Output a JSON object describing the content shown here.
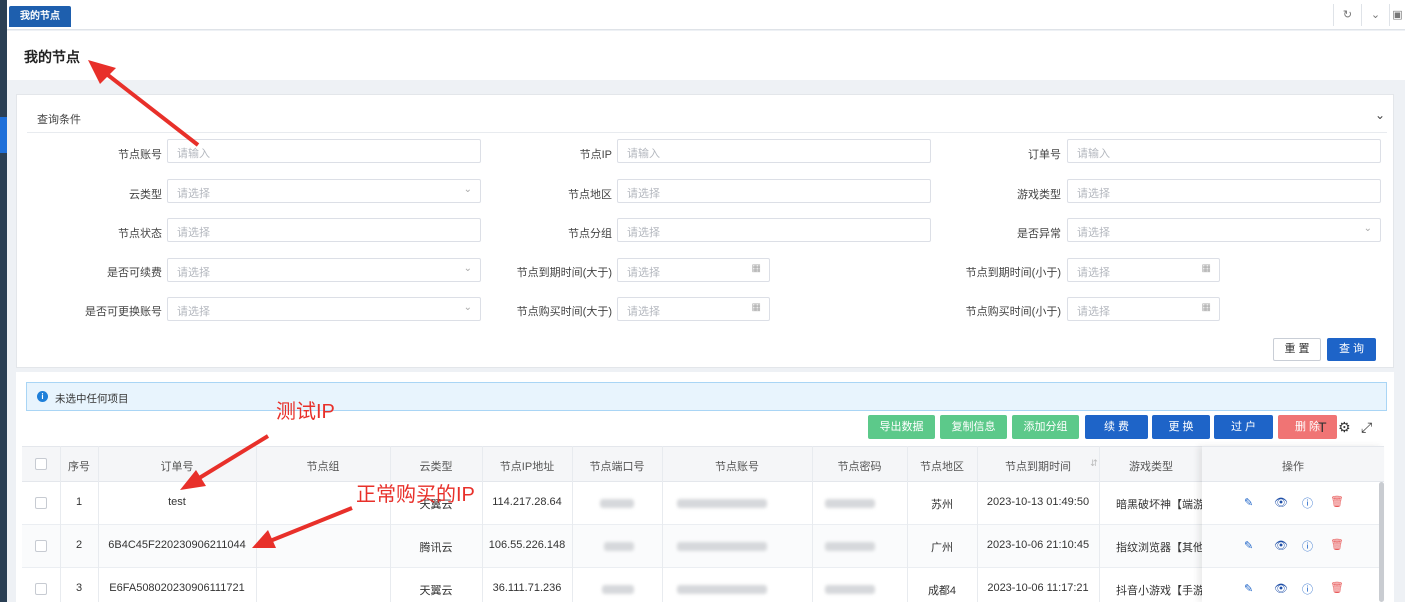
{
  "tabs": {
    "active_label": "我的节点"
  },
  "page": {
    "title": "我的节点"
  },
  "query": {
    "title": "查询条件",
    "fields": [
      {
        "label": "节点账号",
        "placeholder": "请输入"
      },
      {
        "label": "节点IP",
        "placeholder": "请输入"
      },
      {
        "label": "订单号",
        "placeholder": "请输入"
      },
      {
        "label": "云类型",
        "placeholder": "请选择"
      },
      {
        "label": "节点地区",
        "placeholder": "请选择"
      },
      {
        "label": "游戏类型",
        "placeholder": "请选择"
      },
      {
        "label": "节点状态",
        "placeholder": "请选择"
      },
      {
        "label": "节点分组",
        "placeholder": "请选择"
      },
      {
        "label": "是否异常",
        "placeholder": "请选择"
      },
      {
        "label": "是否可续费",
        "placeholder": "请选择"
      },
      {
        "label": "节点到期时间(大于)",
        "placeholder": "请选择"
      },
      {
        "label": "节点到期时间(小于)",
        "placeholder": "请选择"
      },
      {
        "label": "是否可更换账号",
        "placeholder": "请选择"
      },
      {
        "label": "节点购买时间(大于)",
        "placeholder": "请选择"
      },
      {
        "label": "节点购买时间(小于)",
        "placeholder": "请选择"
      }
    ],
    "reset_label": "重 置",
    "search_label": "查 询"
  },
  "selection": {
    "text": "未选中任何项目"
  },
  "toolbar": {
    "export": "导出数据",
    "copy": "复制信息",
    "add_group": "添加分组",
    "renew": "续 费",
    "replace": "更 换",
    "transfer": "过 户",
    "delete": "删 除"
  },
  "colors": {
    "primary": "#1e64c8",
    "green": "#5cc98a",
    "danger": "#f07474",
    "annotation": "#e8302a"
  },
  "table": {
    "headers": [
      "序号",
      "订单号",
      "节点组",
      "云类型",
      "节点IP地址",
      "节点端口号",
      "节点账号",
      "节点密码",
      "节点地区",
      "节点到期时间",
      "游戏类型",
      "操作"
    ],
    "rows": [
      {
        "no": "1",
        "order": "test",
        "group": "",
        "cloud": "天翼云",
        "ip": "114.217.28.64",
        "region": "苏州",
        "expire": "2023-10-13 01:49:50",
        "game": "暗黑破坏神【端游"
      },
      {
        "no": "2",
        "order": "6B4C45F220230906211044",
        "group": "",
        "cloud": "腾讯云",
        "ip": "106.55.226.148",
        "region": "广州",
        "expire": "2023-10-06 21:10:45",
        "game": "指纹浏览器【其他"
      },
      {
        "no": "3",
        "order": "E6FA508020230906111721",
        "group": "",
        "cloud": "天翼云",
        "ip": "36.111.71.236",
        "region": "成都4",
        "expire": "2023-10-06 11:17:21",
        "game": "抖音小游戏【手游"
      }
    ]
  },
  "annotations": {
    "test_ip": "测试IP",
    "normal_ip": "正常购买的IP"
  }
}
